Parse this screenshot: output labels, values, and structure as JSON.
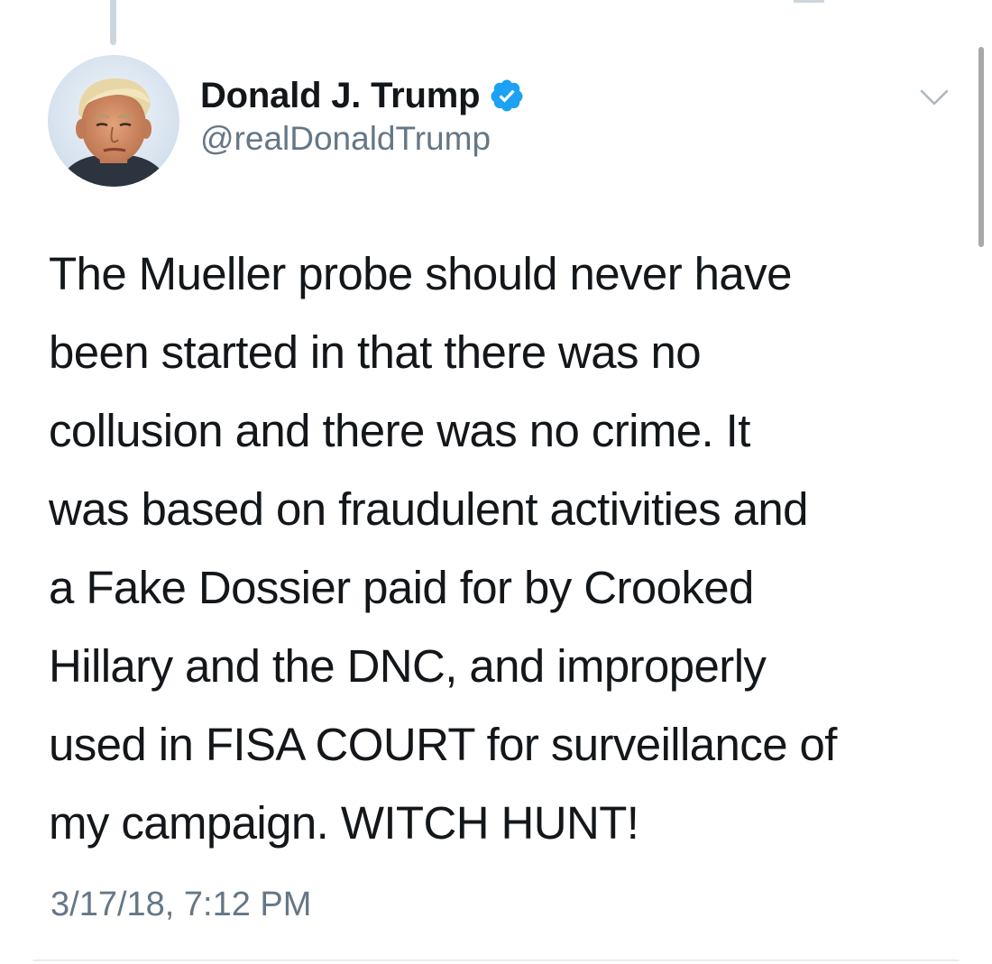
{
  "tweet": {
    "author": {
      "display_name": "Donald J. Trump",
      "handle": "@realDonaldTrump",
      "verified": true,
      "avatar": "profile-photo"
    },
    "text_lines": [
      "The Mueller probe should never have",
      "been started in that there was no",
      "collusion and there was no crime. It",
      "was based on fraudulent activities and",
      "a Fake Dossier paid for by Crooked",
      "Hillary and the DNC, and improperly",
      "used in FISA COURT for surveillance of",
      "my campaign. WITCH HUNT!"
    ],
    "timestamp": "3/17/18, 7:12 PM",
    "menu_icon": "chevron-down-icon"
  },
  "colors": {
    "primary_text": "#14171a",
    "secondary_text": "#657786",
    "verified_badge": "#1da1f2",
    "divider": "#e6ecf0",
    "thread_line": "#ccd6dd"
  }
}
